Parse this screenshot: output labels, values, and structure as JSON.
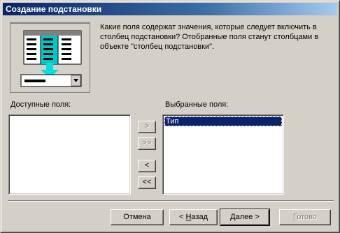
{
  "window": {
    "title": "Создание подстановки"
  },
  "description": "Какие поля содержат значения, которые следует включить в\nстолбец подстановки? Отобранные поля станут столбцами в\nобъекте \"столбец подстановки\".",
  "available": {
    "label": "Доступные поля:",
    "items": []
  },
  "selected": {
    "label": "Выбранные поля:",
    "items": [
      "Тип"
    ]
  },
  "move_buttons": {
    "add_one": ">",
    "add_all": ">>",
    "remove_one": "<",
    "remove_all": "<<"
  },
  "footer": {
    "cancel": "Отмена",
    "back_prefix": "< ",
    "back_hotkey": "Н",
    "back_rest": "азад",
    "next_hotkey": "Д",
    "next_rest": "алее >",
    "finish_hotkey": "Г",
    "finish_rest": "отово"
  },
  "colors": {
    "titlebar_start": "#0a246a",
    "titlebar_end": "#a6caf0",
    "face": "#d4d0c8",
    "selection": "#0a246a",
    "arrow": "#00e0e0"
  }
}
